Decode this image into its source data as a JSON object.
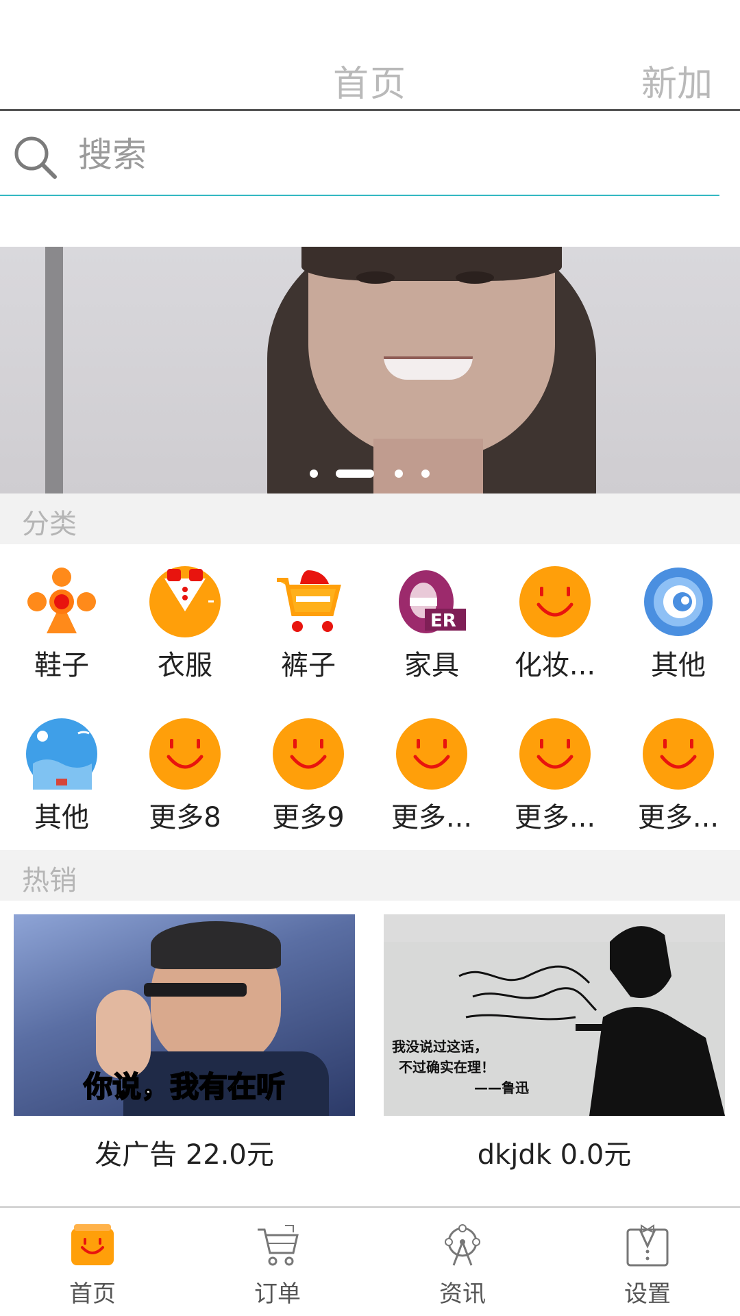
{
  "header": {
    "title": "首页",
    "new_label": "新加"
  },
  "search": {
    "placeholder": "搜索"
  },
  "banner": {
    "slide_count": 4,
    "active_index": 1
  },
  "sections": {
    "category_title": "分类",
    "hot_title": "热销"
  },
  "categories": [
    {
      "label": "鞋子",
      "icon": "orange-people-icon"
    },
    {
      "label": "衣服",
      "icon": "orange-shirt-icon"
    },
    {
      "label": "裤子",
      "icon": "shopping-cart-icon"
    },
    {
      "label": "家具",
      "icon": "purple-er-logo-icon"
    },
    {
      "label": "化妆...",
      "icon": "smiley-icon"
    },
    {
      "label": "其他",
      "icon": "blue-swirl-icon"
    },
    {
      "label": "其他",
      "icon": "blue-sky-icon"
    },
    {
      "label": "更多8",
      "icon": "smiley-icon"
    },
    {
      "label": "更多9",
      "icon": "smiley-icon"
    },
    {
      "label": "更多...",
      "icon": "smiley-icon"
    },
    {
      "label": "更多...",
      "icon": "smiley-icon"
    },
    {
      "label": "更多...",
      "icon": "smiley-icon"
    }
  ],
  "products": [
    {
      "caption": "发广告 22.0元",
      "image_text": "你说，我有在听"
    },
    {
      "caption": "dkjdk 0.0元",
      "image_text_lines": [
        "我没说过这话，",
        "不过确实在理！",
        "——鲁迅"
      ]
    }
  ],
  "bottom_nav": [
    {
      "label": "首页",
      "icon": "home-bag-icon",
      "active": true
    },
    {
      "label": "订单",
      "icon": "cart-icon"
    },
    {
      "label": "资讯",
      "icon": "ferris-wheel-icon"
    },
    {
      "label": "设置",
      "icon": "tuxedo-icon"
    }
  ],
  "colors": {
    "accent_orange": "#ff9f0a",
    "search_underline": "#33b8c2",
    "section_bg": "#f2f2f2"
  }
}
